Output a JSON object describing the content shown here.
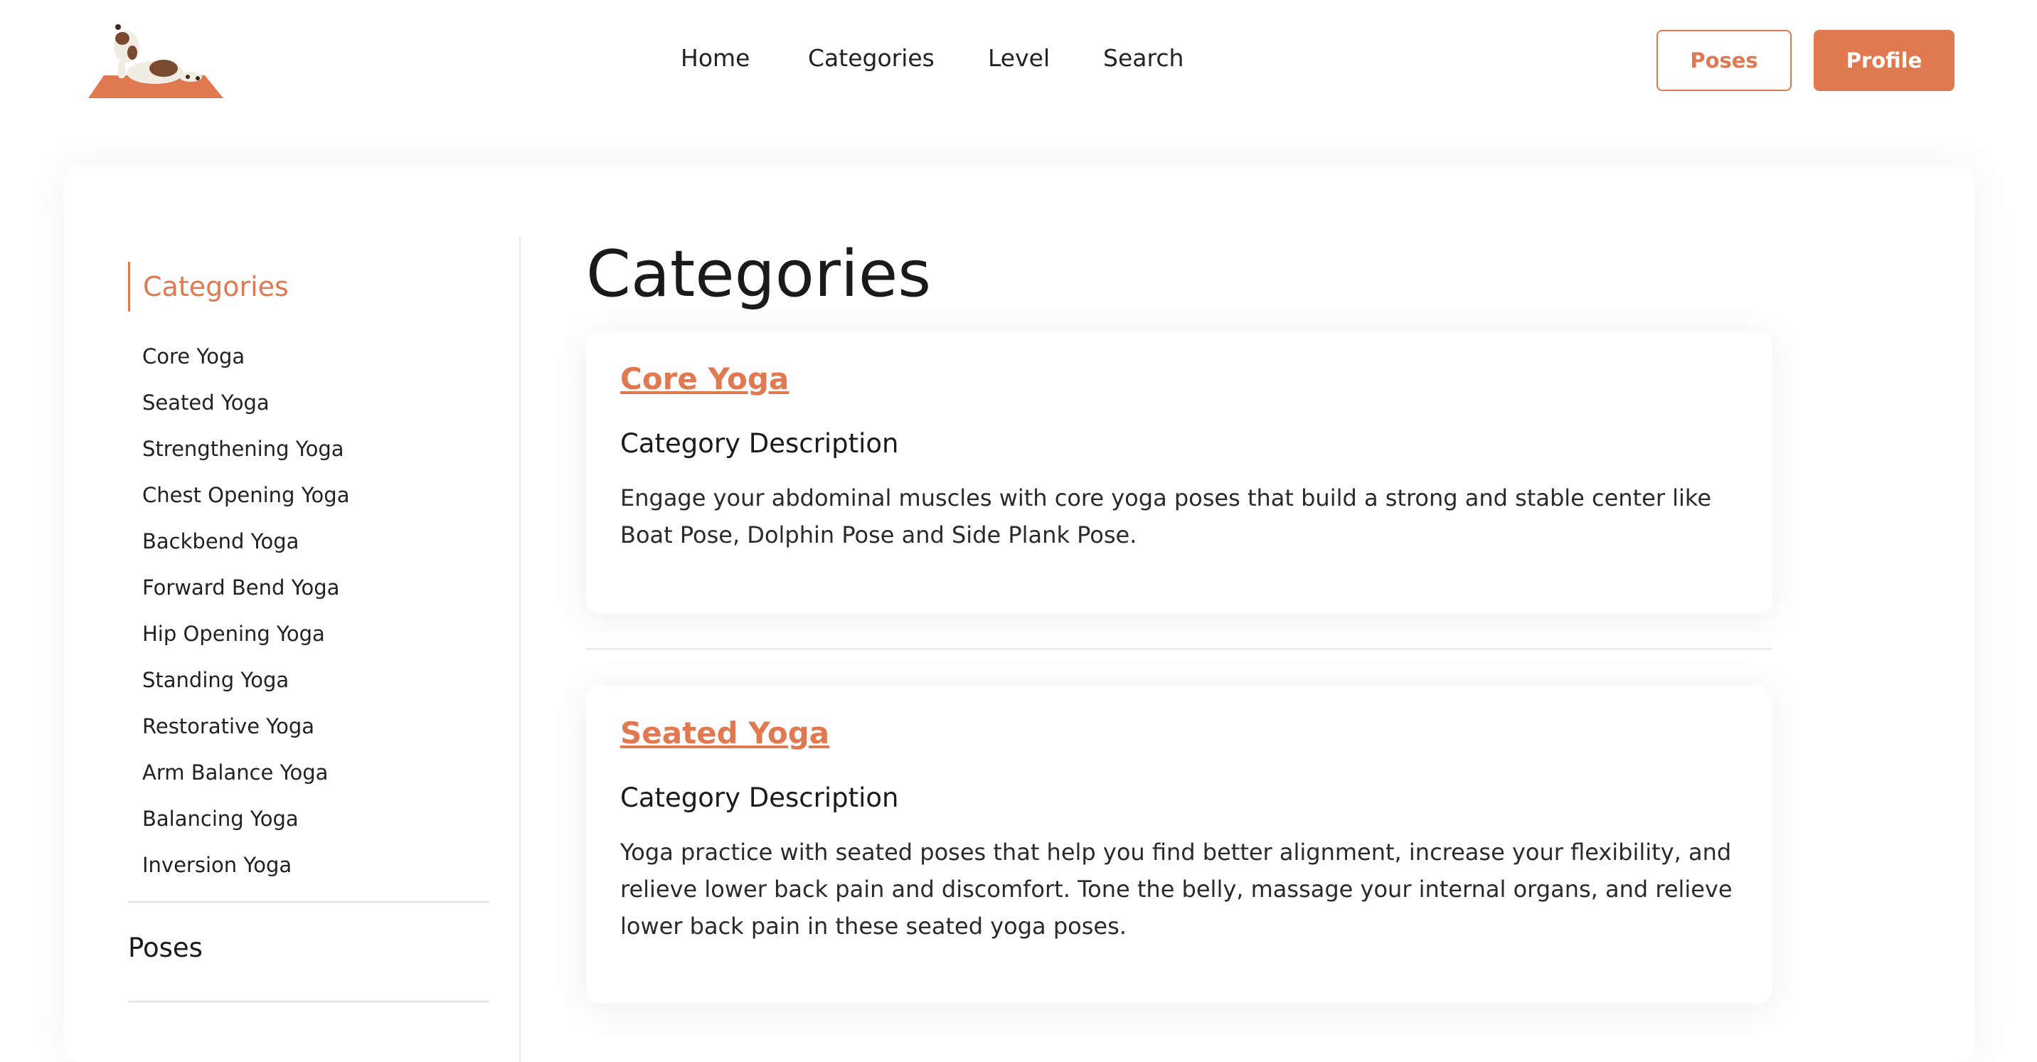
{
  "header": {
    "nav": [
      "Home",
      "Categories",
      "Level",
      "Search"
    ],
    "poses_button": "Poses",
    "profile_button": "Profile"
  },
  "sidebar": {
    "title": "Categories",
    "items": [
      "Core Yoga",
      "Seated Yoga",
      "Strengthening Yoga",
      "Chest Opening Yoga",
      "Backbend Yoga",
      "Forward Bend Yoga",
      "Hip Opening Yoga",
      "Standing Yoga",
      "Restorative Yoga",
      "Arm Balance Yoga",
      "Balancing Yoga",
      "Inversion Yoga"
    ],
    "poses_label": "Poses"
  },
  "main": {
    "title": "Categories",
    "cards": [
      {
        "name": "Core Yoga",
        "subtitle": "Category Description",
        "description": "Engage your abdominal muscles with core yoga poses that build a strong and stable center like Boat Pose, Dolphin Pose and Side Plank Pose."
      },
      {
        "name": "Seated Yoga",
        "subtitle": "Category Description",
        "description": "Yoga practice with seated poses that help you find better alignment, increase your flexibility, and relieve lower back pain and discomfort. Tone the belly, massage your internal organs, and relieve lower back pain in these seated yoga poses."
      }
    ]
  },
  "colors": {
    "accent": "#e07850",
    "text": "#1f1f1f",
    "background": "#ffffff"
  },
  "icons": {
    "logo": "dog-on-yoga-mat-logo"
  }
}
